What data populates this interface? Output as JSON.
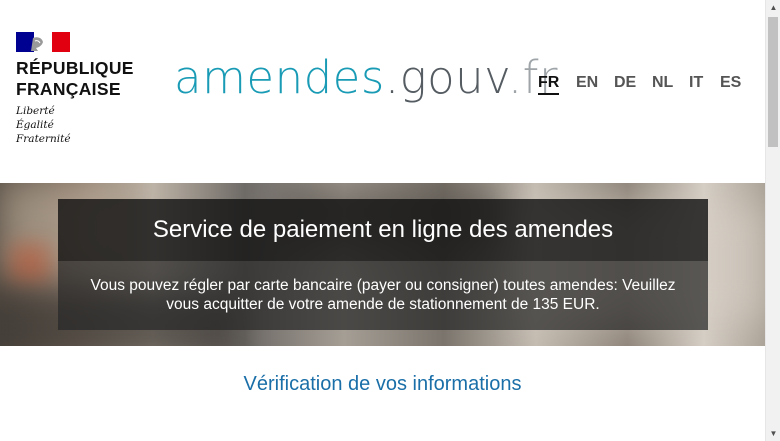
{
  "header": {
    "rf_line1": "RÉPUBLIQUE",
    "rf_line2": "FRANÇAISE",
    "motto": [
      "Liberté",
      "Égalité",
      "Fraternité"
    ],
    "site_logo": {
      "part1": "amendes",
      "part2": ".gouv",
      "part3": ".fr"
    },
    "languages": [
      {
        "code": "FR",
        "active": true
      },
      {
        "code": "EN",
        "active": false
      },
      {
        "code": "DE",
        "active": false
      },
      {
        "code": "NL",
        "active": false
      },
      {
        "code": "IT",
        "active": false
      },
      {
        "code": "ES",
        "active": false
      }
    ]
  },
  "hero": {
    "title": "Service de paiement en ligne des amendes",
    "text": "Vous pouvez régler par carte bancaire (payer ou consigner) toutes amendes: Veuillez vous acquitter de votre amende de stationnement de 135 EUR."
  },
  "main": {
    "section_title": "Vérification de vos informations"
  },
  "colors": {
    "accent_teal": "#1a9bb5",
    "link_blue": "#1a6fa8",
    "flag_blue": "#000091",
    "flag_red": "#e1000f"
  },
  "icons": {
    "scroll_up": "triangle-up-icon",
    "scroll_down": "triangle-down-icon"
  }
}
